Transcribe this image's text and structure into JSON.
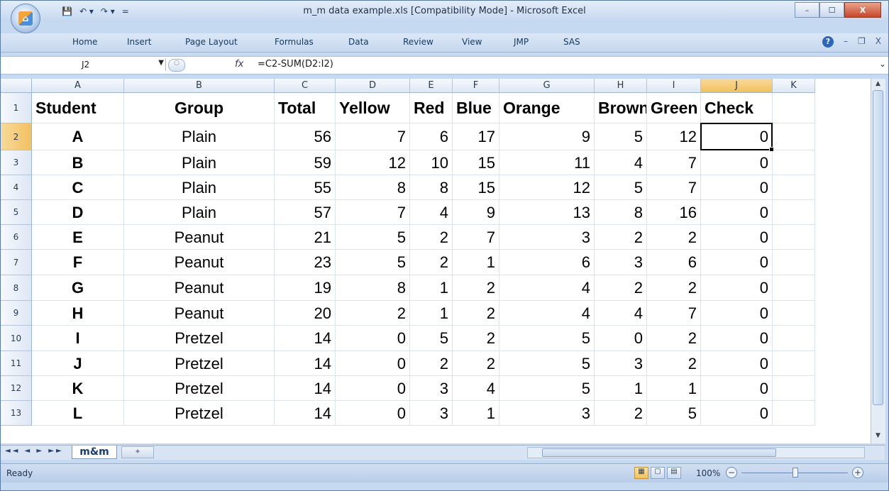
{
  "window": {
    "title": "m_m data example.xls  [Compatibility Mode] - Microsoft Excel",
    "controls": {
      "minimize": "–",
      "maximize": "☐",
      "close": "X"
    }
  },
  "qat": {
    "save": "💾",
    "undo": "↶ ▾",
    "redo": "↷ ▾",
    "more": "="
  },
  "ribbon": {
    "tabs": [
      "Home",
      "Insert",
      "Page Layout",
      "Formulas",
      "Data",
      "Review",
      "View",
      "JMP",
      "SAS"
    ],
    "help": "?",
    "min": "–",
    "restore": "❐",
    "close": "X"
  },
  "formula_bar": {
    "name_box": "J2",
    "fx": "fx",
    "formula": "=C2-SUM(D2:I2)"
  },
  "columns": [
    "A",
    "B",
    "C",
    "D",
    "E",
    "F",
    "G",
    "H",
    "I",
    "J",
    "K"
  ],
  "selected_column": "J",
  "selected_row": 2,
  "table": {
    "header": [
      "Student",
      "Group",
      "Total",
      "Yellow",
      "Red",
      "Blue",
      "Orange",
      "Brown",
      "Green",
      "Check"
    ],
    "rows": [
      [
        "A",
        "Plain",
        "56",
        "7",
        "6",
        "17",
        "9",
        "5",
        "12",
        "0"
      ],
      [
        "B",
        "Plain",
        "59",
        "12",
        "10",
        "15",
        "11",
        "4",
        "7",
        "0"
      ],
      [
        "C",
        "Plain",
        "55",
        "8",
        "8",
        "15",
        "12",
        "5",
        "7",
        "0"
      ],
      [
        "D",
        "Plain",
        "57",
        "7",
        "4",
        "9",
        "13",
        "8",
        "16",
        "0"
      ],
      [
        "E",
        "Peanut",
        "21",
        "5",
        "2",
        "7",
        "3",
        "2",
        "2",
        "0"
      ],
      [
        "F",
        "Peanut",
        "23",
        "5",
        "2",
        "1",
        "6",
        "3",
        "6",
        "0"
      ],
      [
        "G",
        "Peanut",
        "19",
        "8",
        "1",
        "2",
        "4",
        "2",
        "2",
        "0"
      ],
      [
        "H",
        "Peanut",
        "20",
        "2",
        "1",
        "2",
        "4",
        "4",
        "7",
        "0"
      ],
      [
        "I",
        "Pretzel",
        "14",
        "0",
        "5",
        "2",
        "5",
        "0",
        "2",
        "0"
      ],
      [
        "J",
        "Pretzel",
        "14",
        "0",
        "2",
        "2",
        "5",
        "3",
        "2",
        "0"
      ],
      [
        "K",
        "Pretzel",
        "14",
        "0",
        "3",
        "4",
        "5",
        "1",
        "1",
        "0"
      ],
      [
        "L",
        "Pretzel",
        "14",
        "0",
        "3",
        "1",
        "3",
        "2",
        "5",
        "0"
      ]
    ]
  },
  "sheets": {
    "active": "m&m",
    "nav": "◄◄ ◄ ► ►►"
  },
  "status": {
    "text": "Ready",
    "zoom": "100%",
    "zoom_minus": "−",
    "zoom_plus": "+"
  }
}
